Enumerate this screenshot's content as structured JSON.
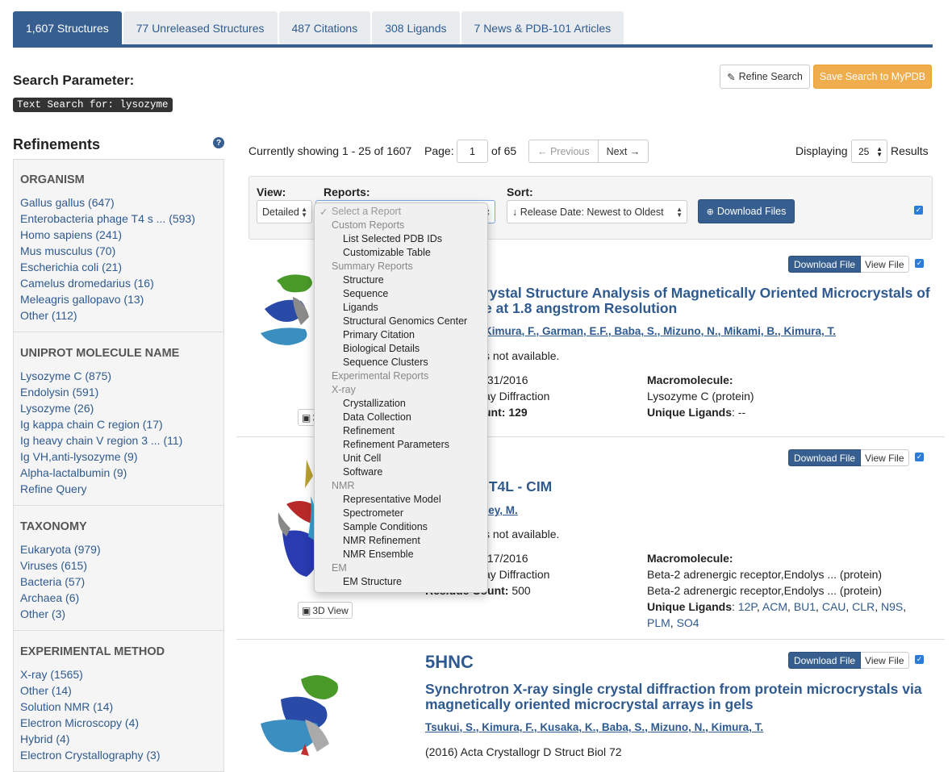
{
  "tabs": [
    {
      "label": "1,607 Structures",
      "active": true
    },
    {
      "label": "77 Unreleased Structures"
    },
    {
      "label": "487 Citations"
    },
    {
      "label": "308 Ligands"
    },
    {
      "label": "7 News & PDB-101 Articles"
    }
  ],
  "search": {
    "heading": "Search Parameter:",
    "query": "Text Search for: lysozyme"
  },
  "actions": {
    "refine": "Refine Search",
    "save": "Save Search to MyPDB"
  },
  "refinements": {
    "title": "Refinements",
    "help_icon": "?",
    "facets": [
      {
        "heading": "ORGANISM",
        "items": [
          "Gallus gallus (647)",
          "Enterobacteria phage T4 s ... (593)",
          "Homo sapiens (241)",
          "Mus musculus (70)",
          "Escherichia coli (21)",
          "Camelus dromedarius (16)",
          "Meleagris gallopavo (13)",
          "Other (112)"
        ]
      },
      {
        "heading": "UNIPROT MOLECULE NAME",
        "items": [
          "Lysozyme C (875)",
          "Endolysin (591)",
          "Lysozyme (26)",
          "Ig kappa chain C region (17)",
          "Ig heavy chain V region 3 ... (11)",
          "Ig VH,anti-lysozyme (9)",
          "Alpha-lactalbumin (9)",
          "Refine Query"
        ]
      },
      {
        "heading": "TAXONOMY",
        "items": [
          "Eukaryota (979)",
          "Viruses (615)",
          "Bacteria (57)",
          "Archaea (6)",
          "Other (3)"
        ]
      },
      {
        "heading": "EXPERIMENTAL METHOD",
        "items": [
          "X-ray (1565)",
          "Other (14)",
          "Solution NMR (14)",
          "Electron Microscopy (4)",
          "Hybrid (4)",
          "Electron Crystallography (3)"
        ]
      }
    ]
  },
  "paging": {
    "showing": "Currently showing 1 - 25 of 1607",
    "page_label": "Page:",
    "page": "1",
    "of": "of 65",
    "prev": "← Previous",
    "next": "Next →",
    "displaying": "Displaying",
    "per_page": "25",
    "results": "Results"
  },
  "toolbar": {
    "view_label": "View:",
    "view_value": "Detailed",
    "reports_label": "Reports:",
    "sort_label": "Sort:",
    "sort_value": "↓ Release Date: Newest to Oldest",
    "download": "Download Files"
  },
  "reports_dropdown": {
    "check": "✓",
    "items": [
      {
        "text": "Select a Report",
        "kind": "first"
      },
      {
        "text": "Custom Reports",
        "kind": "group"
      },
      {
        "text": "List Selected PDB IDs",
        "kind": "opt"
      },
      {
        "text": "Customizable Table",
        "kind": "opt"
      },
      {
        "text": "Summary Reports",
        "kind": "group"
      },
      {
        "text": "Structure",
        "kind": "opt"
      },
      {
        "text": "Sequence",
        "kind": "opt"
      },
      {
        "text": "Ligands",
        "kind": "opt"
      },
      {
        "text": "Structural Genomics Center",
        "kind": "opt"
      },
      {
        "text": "Primary Citation",
        "kind": "opt"
      },
      {
        "text": "Biological Details",
        "kind": "opt"
      },
      {
        "text": "Sequence Clusters",
        "kind": "opt"
      },
      {
        "text": "Experimental Reports",
        "kind": "group"
      },
      {
        "text": "X-ray",
        "kind": "group"
      },
      {
        "text": "Crystallization",
        "kind": "opt"
      },
      {
        "text": "Data Collection",
        "kind": "opt"
      },
      {
        "text": "Refinement",
        "kind": "opt"
      },
      {
        "text": "Refinement Parameters",
        "kind": "opt"
      },
      {
        "text": "Unit Cell",
        "kind": "opt"
      },
      {
        "text": "Software",
        "kind": "opt"
      },
      {
        "text": "NMR",
        "kind": "group"
      },
      {
        "text": "Representative Model",
        "kind": "opt"
      },
      {
        "text": "Spectrometer",
        "kind": "opt"
      },
      {
        "text": "Sample Conditions",
        "kind": "opt"
      },
      {
        "text": "NMR Refinement",
        "kind": "opt"
      },
      {
        "text": "NMR Ensemble",
        "kind": "opt"
      },
      {
        "text": "EM",
        "kind": "group"
      },
      {
        "text": "EM Structure",
        "kind": "opt"
      }
    ]
  },
  "common": {
    "download_file": "Download File",
    "view_file": "View File",
    "view3d": "3D View",
    "view3d_short": "3"
  },
  "results": [
    {
      "title_line1": "rystal Structure Analysis of Magnetically Oriented Microcrystals of",
      "title_line2": "e at 1.8 angstrom Resolution",
      "authors": [
        "Kimura, F.",
        "Garman, E.F.",
        "Baba, S.",
        "Mizuno, N.",
        "Mikami, B.",
        "Kimura, T."
      ],
      "abstract": "s not available.",
      "release": "/31/2016",
      "method": "ay Diffraction",
      "residue": "unt: 129",
      "macro_label": "Macromolecule:",
      "macro_lines": [
        "Lysozyme C (protein)"
      ],
      "ligands_label": "Unique Ligands",
      "ligands_text": ": --"
    },
    {
      "title_line1": "-T4L - CIM",
      "authors_text": "rey, M.",
      "abstract": "s not available.",
      "release": "/17/2016",
      "method": "ay Diffraction",
      "residue_label": "Residue Count:",
      "residue_value": " 500",
      "macro_label": "Macromolecule:",
      "macro_lines": [
        "Beta-2 adrenergic receptor,Endolys ... (protein)",
        "Beta-2 adrenergic receptor,Endolys ... (protein)"
      ],
      "ligands_label": "Unique Ligands",
      "ligands": [
        "12P",
        "ACM",
        "BU1",
        "CAU",
        "CLR",
        "N9S",
        "PLM",
        "SO4"
      ]
    },
    {
      "id": "5HNC",
      "title_line1": "Synchrotron X-ray single crystal diffraction from protein microcrystals via",
      "title_line2": "magnetically oriented microcrystal arrays in gels",
      "authors": [
        "Tsukui, S.",
        "Kimura, F.",
        "Kusaka, K.",
        "Baba, S.",
        "Mizuno, N.",
        "Kimura, T."
      ],
      "citation": "(2016) Acta Crystallogr D Struct Biol 72"
    }
  ]
}
